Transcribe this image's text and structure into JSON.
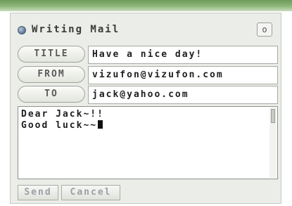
{
  "window": {
    "title": "Writing Mail",
    "close_label": "o"
  },
  "fields": {
    "title": {
      "label": "TITLE",
      "value": "Have a nice day!"
    },
    "from": {
      "label": "FROM",
      "value": "vizufon@vizufon.com"
    },
    "to": {
      "label": "TO",
      "value": "jack@yahoo.com"
    }
  },
  "body": {
    "line1": "Dear Jack~!!",
    "line2": "Good luck~~"
  },
  "buttons": {
    "send_label": "Send",
    "cancel_label": "Cancel"
  },
  "colors": {
    "top_band": "#8fb87a",
    "window_bg": "#ebede8",
    "disabled_text": "#9aa0a6"
  },
  "icons": {
    "title_icon": "mail-bullet-icon",
    "close_icon": "close-icon",
    "caret": "text-cursor"
  }
}
